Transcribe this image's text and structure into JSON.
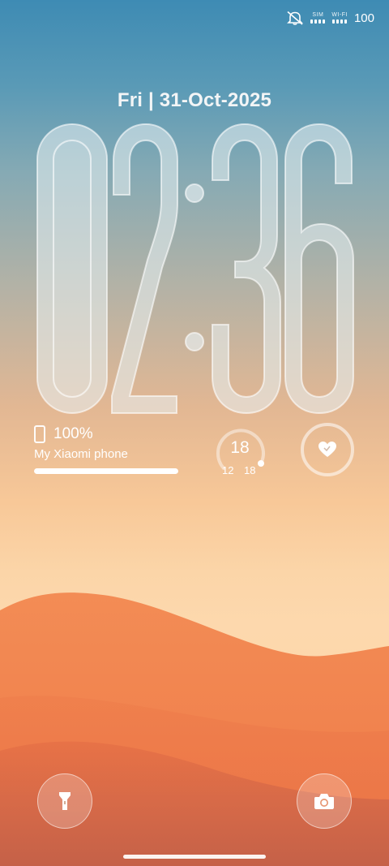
{
  "status_bar": {
    "icons": [
      "mute-icon",
      "sim-signal-icon",
      "wifi-signal-icon"
    ],
    "sim_label": "SIM",
    "wifi_label": "WI-FI",
    "battery": "100"
  },
  "lockscreen": {
    "date": "Fri | 31-Oct-2025",
    "clock": {
      "hours": "02",
      "minutes": "36"
    }
  },
  "battery_widget": {
    "percent": "100%",
    "device_name": "My Xiaomi phone",
    "level": 1.0,
    "icon": "phone-icon"
  },
  "weather_widget": {
    "temp": "18",
    "low": "12",
    "high": "18",
    "level": 1.0
  },
  "health_widget": {
    "icon": "heart-icon"
  },
  "shortcuts": {
    "left_icon": "flashlight-icon",
    "right_icon": "camera-icon"
  },
  "colors": {
    "sky_top": "#3e8bb4",
    "sand_light": "#fdd8ad",
    "dune": "#f48850",
    "dune_dark": "#ee6f42"
  }
}
